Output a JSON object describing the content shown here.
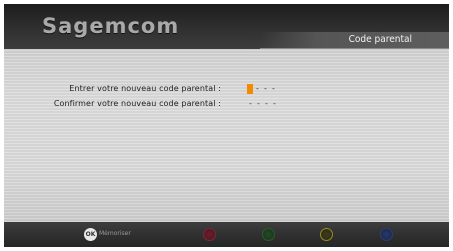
{
  "header": {
    "brand": "Sagemcom",
    "title": "Code parental"
  },
  "form": {
    "new_code_label": "Entrer votre nouveau code parental :",
    "confirm_code_label": "Confirmer votre nouveau code parental :",
    "new_code_digits": [
      "",
      "-",
      "-",
      "-"
    ],
    "confirm_code_digits": [
      "-",
      "-",
      "-",
      "-"
    ],
    "active_digit_color": "#f28a00"
  },
  "footer": {
    "ok_button_text": "OK",
    "ok_label": "Mémoriser",
    "color_buttons": [
      {
        "name": "red",
        "color": "#6a1f2c"
      },
      {
        "name": "green",
        "color": "#234a26"
      },
      {
        "name": "yellow",
        "color": "#9a8a20"
      },
      {
        "name": "blue",
        "color": "#253868"
      }
    ]
  }
}
